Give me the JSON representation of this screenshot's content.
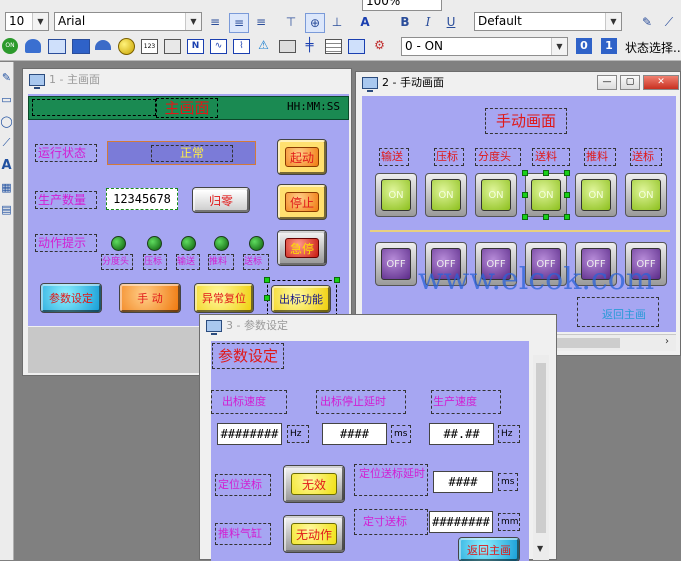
{
  "toolbar1": {
    "font_size": "10",
    "font_name": "Arial",
    "zoom": "100%",
    "style_combo": "Default"
  },
  "toolbar2": {
    "state_combo": "0 - ON",
    "index0": "0",
    "index1": "1",
    "state_select_label": "状态选择..",
    "on_icon": "ON"
  },
  "window_main": {
    "title": "1 - 主画面",
    "banner_title": "主画面",
    "banner_time": "HH:MM:SS",
    "status_label": "运行状态",
    "status_value": "正常",
    "count_label": "生产数量",
    "count_value": "12345678",
    "reset_label": "归零",
    "action_label": "动作提示",
    "leds": [
      "分度头",
      "压标",
      "输送",
      "推料",
      "送标"
    ],
    "start_label": "起动",
    "stop_label": "停止",
    "emergency_label": "急停",
    "param_button": "参数设定",
    "manual_button": "手 动",
    "fault_reset_button": "异常复位",
    "label_function_button": "出标功能"
  },
  "window_manual": {
    "title": "2 - 手动画面",
    "heading": "手动画面",
    "columns": [
      "输送",
      "压标",
      "分度头",
      "送料",
      "推料",
      "送标"
    ],
    "on_text": "ON",
    "off_text": "OFF",
    "back_button": "返回主画",
    "watermark": "www.elcok.com"
  },
  "window_param": {
    "title": "3 - 参数设定",
    "heading": "参数设定",
    "label_speed": "出标速度",
    "label_stop_delay": "出标停止延时",
    "label_prod_speed": "生产速度",
    "speed_value": "########",
    "speed_unit": "Hz",
    "stop_delay_value": "####",
    "stop_delay_unit": "ms",
    "prod_speed_value": "##.##",
    "prod_speed_unit": "Hz",
    "label_position_feed": "定位送标",
    "invalid_button": "无效",
    "label_position_delay": "定位送标延时",
    "position_delay_value": "####",
    "position_delay_unit": "ms",
    "label_pusher": "推料气缸",
    "no_action_button": "无动作",
    "label_fixed_feed": "定寸送标",
    "fixed_feed_value": "########",
    "fixed_feed_unit": "mm",
    "back_button": "返回主画"
  }
}
